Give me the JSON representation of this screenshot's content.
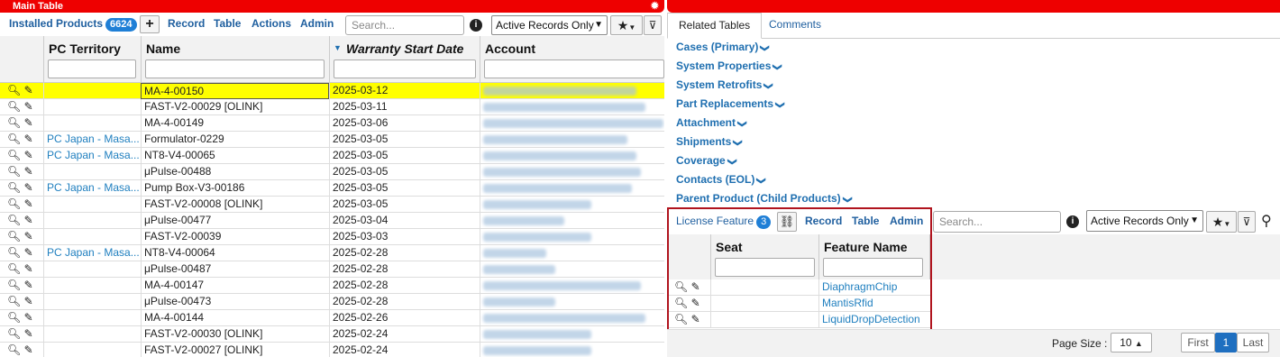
{
  "left": {
    "title": "Main Table",
    "toolbar": {
      "installed_label": "Installed Products",
      "count": "6624",
      "record": "Record",
      "table": "Table",
      "actions": "Actions",
      "admin": "Admin",
      "search_placeholder": "Search...",
      "filter_select": "Active Records Only"
    },
    "columns": [
      "PC Territory",
      "Name",
      "Warranty Start Date",
      "Account"
    ],
    "rows": [
      {
        "territory": "",
        "name": "MA-4-00150",
        "date": "2025-03-12"
      },
      {
        "territory": "",
        "name": "FAST-V2-00029 [OLINK]",
        "date": "2025-03-11"
      },
      {
        "territory": "",
        "name": "MA-4-00149",
        "date": "2025-03-06"
      },
      {
        "territory": "PC Japan - Masa...",
        "name": "Formulator-0229",
        "date": "2025-03-05"
      },
      {
        "territory": "PC Japan - Masa...",
        "name": "NT8-V4-00065",
        "date": "2025-03-05"
      },
      {
        "territory": "",
        "name": "μPulse-00488",
        "date": "2025-03-05"
      },
      {
        "territory": "PC Japan - Masa...",
        "name": "Pump Box-V3-00186",
        "date": "2025-03-05"
      },
      {
        "territory": "",
        "name": "FAST-V2-00008 [OLINK]",
        "date": "2025-03-05"
      },
      {
        "territory": "",
        "name": "μPulse-00477",
        "date": "2025-03-04"
      },
      {
        "territory": "",
        "name": "FAST-V2-00039",
        "date": "2025-03-03"
      },
      {
        "territory": "PC Japan - Masa...",
        "name": "NT8-V4-00064",
        "date": "2025-02-28"
      },
      {
        "territory": "",
        "name": "μPulse-00487",
        "date": "2025-02-28"
      },
      {
        "territory": "",
        "name": "MA-4-00147",
        "date": "2025-02-28"
      },
      {
        "territory": "",
        "name": "μPulse-00473",
        "date": "2025-02-28"
      },
      {
        "territory": "",
        "name": "MA-4-00144",
        "date": "2025-02-26"
      },
      {
        "territory": "",
        "name": "FAST-V2-00030 [OLINK]",
        "date": "2025-02-24"
      },
      {
        "territory": "",
        "name": "FAST-V2-00027 [OLINK]",
        "date": "2025-02-24"
      }
    ]
  },
  "right": {
    "tabs": [
      "Related Tables",
      "Comments"
    ],
    "related": [
      "Cases (Primary)",
      "System Properties",
      "System Retrofits",
      "Part Replacements",
      "Attachment",
      "Shipments",
      "Coverage",
      "Contacts (EOL)",
      "Parent Product (Child Products)"
    ],
    "sub": {
      "label": "License Feature",
      "count": "3",
      "record": "Record",
      "table": "Table",
      "admin": "Admin",
      "search_placeholder": "Search...",
      "filter_select": "Active Records Only",
      "columns": [
        "Seat",
        "Feature Name"
      ],
      "rows": [
        "DiaphragmChip",
        "MantisRfid",
        "LiquidDropDetection"
      ]
    },
    "pager": {
      "page_size_label": "Page Size :",
      "page_size": "10",
      "first": "First",
      "page": "1",
      "last": "Last"
    }
  }
}
